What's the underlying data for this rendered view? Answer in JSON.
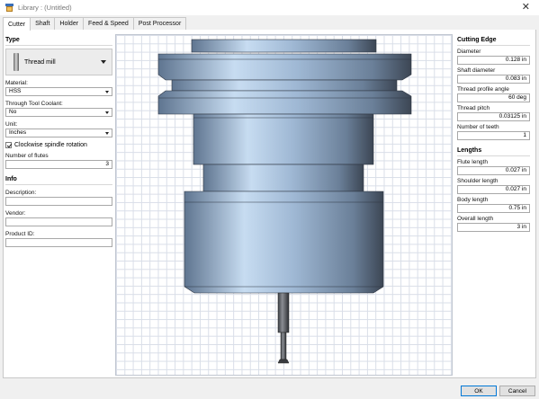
{
  "window": {
    "title": "Library : (Untitled)",
    "close_glyph": "✕"
  },
  "tabs": [
    "Cutter",
    "Shaft",
    "Holder",
    "Feed & Speed",
    "Post Processor"
  ],
  "left": {
    "type_header": "Type",
    "cutter_type": "Thread mill",
    "material_label": "Material:",
    "material_value": "HSS",
    "coolant_label": "Through Tool Coolant:",
    "coolant_value": "No",
    "unit_label": "Unit:",
    "unit_value": "Inches",
    "clockwise_label": "Clockwise spindle rotation",
    "flutes_label": "Number of flutes",
    "flutes_value": "3",
    "info_header": "Info",
    "description_label": "Description:",
    "description_value": "",
    "vendor_label": "Vendor:",
    "vendor_value": "",
    "product_label": "Product ID:",
    "product_value": ""
  },
  "right": {
    "cutting_edge_header": "Cutting Edge",
    "diameter_label": "Diameter",
    "diameter_value": "0.128 in",
    "shaft_diameter_label": "Shaft diameter",
    "shaft_diameter_value": "0.083 in",
    "profile_angle_label": "Thread profile angle",
    "profile_angle_value": "60 deg",
    "pitch_label": "Thread pitch",
    "pitch_value": "0.03125 in",
    "teeth_label": "Number of teeth",
    "teeth_value": "1",
    "lengths_header": "Lengths",
    "flute_length_label": "Flute length",
    "flute_length_value": "0.027 in",
    "shoulder_length_label": "Shoulder length",
    "shoulder_length_value": "0.027 in",
    "body_length_label": "Body length",
    "body_length_value": "0.75 in",
    "overall_length_label": "Overall length",
    "overall_length_value": "3 in"
  },
  "buttons": {
    "ok": "OK",
    "cancel": "Cancel"
  },
  "colors": {
    "holder_light": "#c4d9ef",
    "holder_mid": "#8fa9c7",
    "holder_dark": "#3e4a5a",
    "grid": "#d9dee8"
  }
}
